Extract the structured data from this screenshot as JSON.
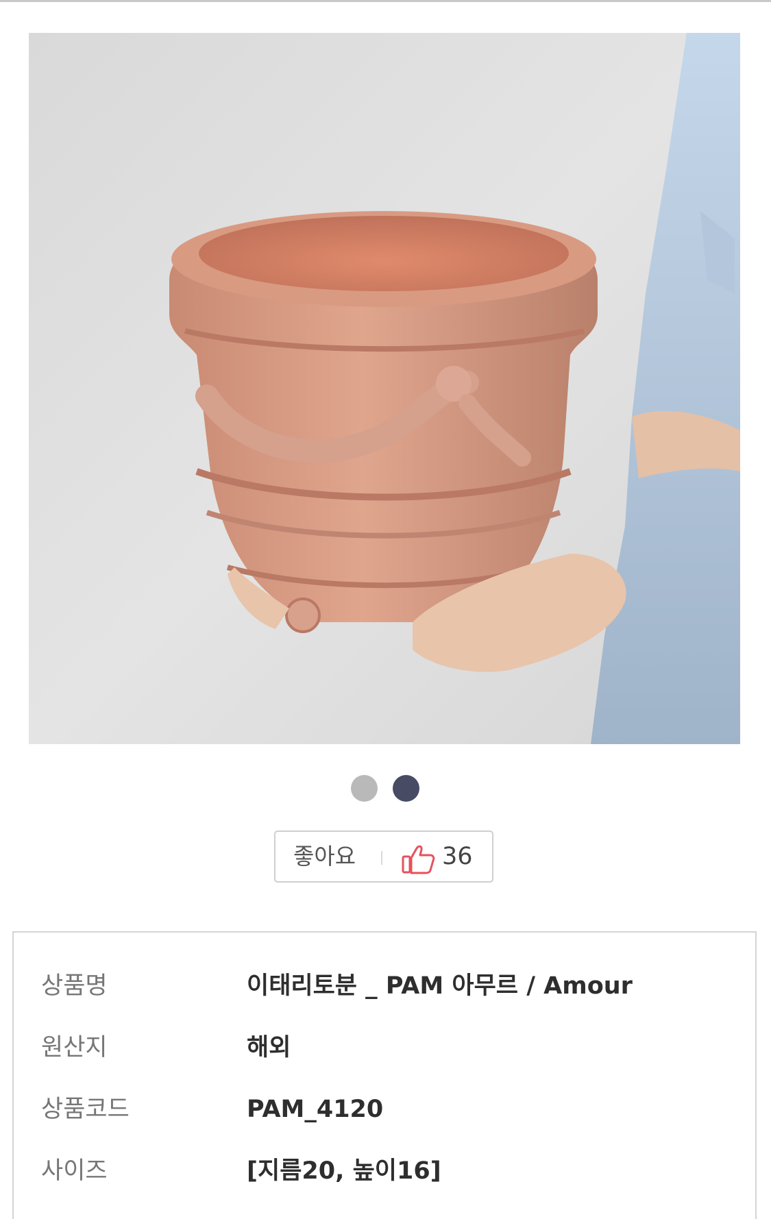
{
  "like": {
    "label": "좋아요",
    "count": "36",
    "icon": "thumbs-up-icon"
  },
  "carousel": {
    "total": 2,
    "active": 2
  },
  "colors": {
    "dot_inactive": "#b9b9b9",
    "dot_active": "#474b64",
    "thumb": "#e8505b"
  },
  "product": {
    "rows": [
      {
        "key": "상품명",
        "value": "이태리토분 _ PAM 아무르 / Amour"
      },
      {
        "key": "원산지",
        "value": "해외"
      },
      {
        "key": "상품코드",
        "value": "PAM_4120"
      },
      {
        "key": "사이즈",
        "value": "[지름20, 높이16]"
      }
    ]
  }
}
